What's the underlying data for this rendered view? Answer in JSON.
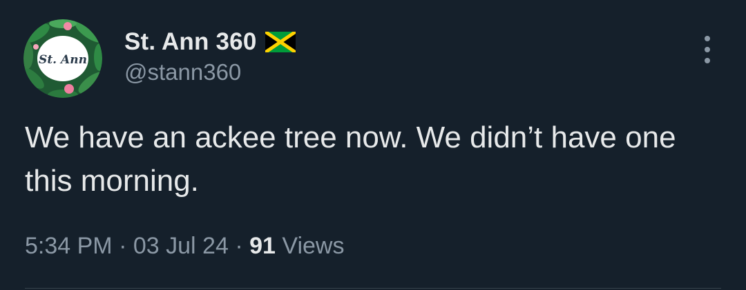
{
  "tweet": {
    "avatar_text": "St. Ann",
    "display_name": "St. Ann 360",
    "flag_icon": "jamaica-flag-icon",
    "handle": "@stann360",
    "text": "We have an ackee tree now. We didn’t have one this morning.",
    "time": "5:34 PM",
    "separator": "·",
    "date": "03 Jul 24",
    "views_count": "91",
    "views_label": "Views"
  },
  "colors": {
    "background": "#15202b",
    "primary_text": "#e7e9ea",
    "secondary_text": "#8b98a5",
    "divider": "#38444d"
  },
  "icons": {
    "more": "more-vertical-icon"
  }
}
